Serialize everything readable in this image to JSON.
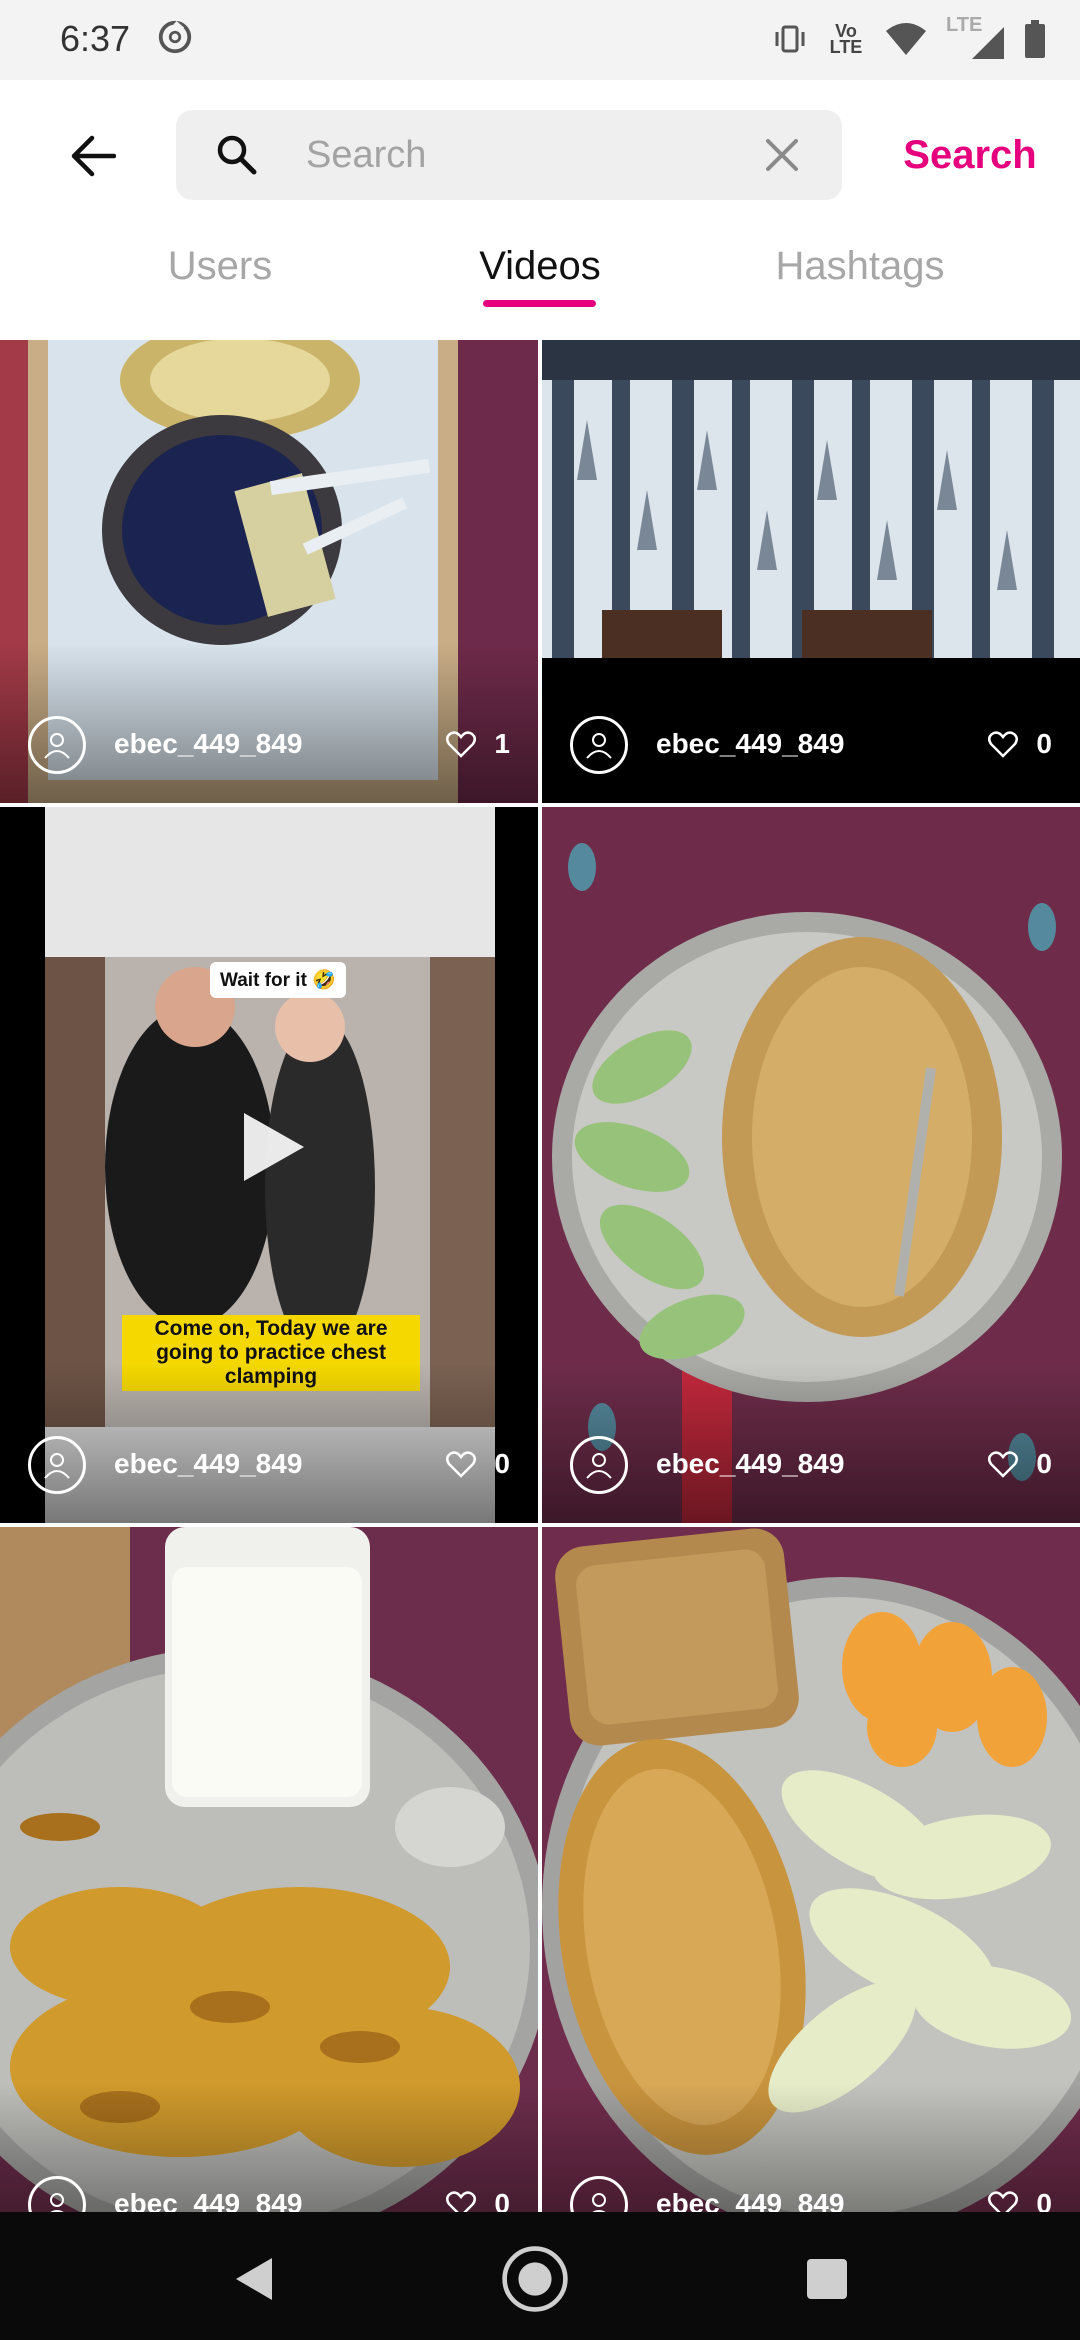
{
  "status_bar": {
    "time": "6:37",
    "left_icon": "sync-icon",
    "right_icons": [
      "vibrate-icon",
      "volte-icon",
      "wifi-icon",
      "lte-signal-icon",
      "battery-icon"
    ],
    "volte_label": "Vo LTE",
    "lte_label": "LTE"
  },
  "header": {
    "back_icon": "back-arrow-icon",
    "search": {
      "placeholder": "Search",
      "value": "",
      "search_icon": "search-icon",
      "clear_icon": "close-icon"
    },
    "search_button_label": "Search"
  },
  "tabs": [
    {
      "label": "Users",
      "active": false
    },
    {
      "label": "Videos",
      "active": true
    },
    {
      "label": "Hashtags",
      "active": false
    }
  ],
  "videos": [
    {
      "username": "ebec_449_849",
      "likes": "1",
      "thumbnail": "cake on tray with name"
    },
    {
      "username": "ebec_449_849",
      "likes": "0",
      "thumbnail": "curtains with tree pattern"
    },
    {
      "username": "ebec_449_849",
      "likes": "0",
      "thumbnail": "gym video",
      "overlay_top": "Wait for it 🤣",
      "overlay_caption": "Come on, Today we are going to practice chest clamping",
      "play_icon": "play-icon"
    },
    {
      "username": "ebec_449_849",
      "likes": "0",
      "thumbnail": "plate with fruit and poha"
    },
    {
      "username": "ebec_449_849",
      "likes": "0",
      "thumbnail": "milk glass and scrambled eggs"
    },
    {
      "username": "ebec_449_849",
      "likes": "0",
      "thumbnail": "toast, omelette and fruit"
    }
  ],
  "nav_bar": {
    "back": "nav-back-icon",
    "home": "nav-home-icon",
    "recents": "nav-recents-icon"
  },
  "colors": {
    "accent": "#e6007e",
    "tab_inactive": "#a7a7a7",
    "search_box_bg": "#efefef",
    "nav_bar_bg": "#0a0a0a"
  }
}
